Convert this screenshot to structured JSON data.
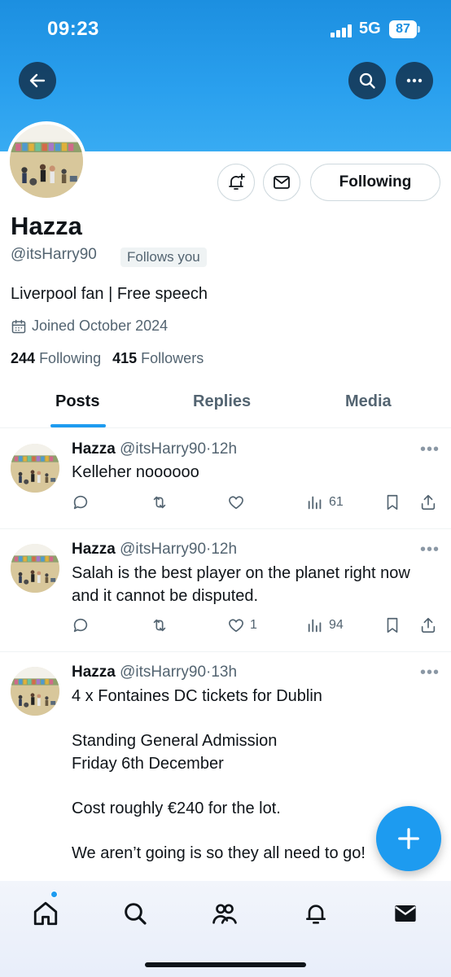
{
  "status_bar": {
    "time": "09:23",
    "network": "5G",
    "battery": "87"
  },
  "profile": {
    "display_name": "Hazza",
    "handle": "@itsHarry90",
    "follows_you_label": "Follows you",
    "bio": "Liverpool fan | Free speech",
    "joined": "Joined October 2024",
    "following_count": "244",
    "following_label": "Following",
    "followers_count": "415",
    "followers_label": "Followers",
    "follow_button_label": "Following"
  },
  "tabs": [
    {
      "label": "Posts",
      "active": true
    },
    {
      "label": "Replies",
      "active": false
    },
    {
      "label": "Media",
      "active": false
    }
  ],
  "posts": [
    {
      "name": "Hazza",
      "handle": "@itsHarry90",
      "time": "·12h",
      "text": "Kelleher noooooo",
      "likes": "",
      "views": "61"
    },
    {
      "name": "Hazza",
      "handle": "@itsHarry90",
      "time": "·12h",
      "text": "Salah is the best player on the planet right now and it cannot be disputed.",
      "likes": "1",
      "views": "94"
    },
    {
      "name": "Hazza",
      "handle": "@itsHarry90",
      "time": "·13h",
      "text": "4 x Fontaines DC tickets for Dublin\n\nStanding General Admission\nFriday 6th December\n\nCost roughly €240 for the lot.\n\nWe aren’t going is so they all need to go!",
      "likes": "",
      "views": ""
    }
  ],
  "bottom_nav": [
    "home-icon",
    "search-icon",
    "communities-icon",
    "notifications-icon",
    "messages-icon"
  ],
  "colors": {
    "accent": "#1d9bf0",
    "banner": "#2aa0ee",
    "text": "#0f1419",
    "muted": "#536471"
  }
}
